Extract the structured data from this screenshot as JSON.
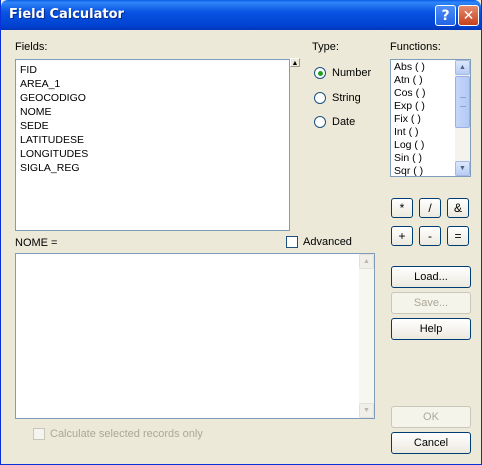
{
  "window": {
    "title": "Field Calculator"
  },
  "titlebar": {
    "help_glyph": "?",
    "close_glyph": "✕"
  },
  "fields": {
    "label": "Fields:",
    "items": [
      "FID",
      "AREA_1",
      "GEOCODIGO",
      "NOME",
      "SEDE",
      "LATITUDESE",
      "LONGITUDES",
      "SIGLA_REG"
    ]
  },
  "type": {
    "label": "Type:",
    "options": [
      "Number",
      "String",
      "Date"
    ],
    "selected": "Number"
  },
  "functions": {
    "label": "Functions:",
    "items": [
      "Abs ( )",
      "Atn ( )",
      "Cos ( )",
      "Exp ( )",
      "Fix ( )",
      "Int ( )",
      "Log ( )",
      "Sin ( )",
      "Sqr ( )"
    ]
  },
  "operators": [
    "*",
    "/",
    "&",
    "+",
    "-",
    "="
  ],
  "expression": {
    "label": "NOME =",
    "value": ""
  },
  "advanced": {
    "label": "Advanced",
    "checked": false
  },
  "buttons": {
    "load": "Load...",
    "save": "Save...",
    "help": "Help",
    "ok": "OK",
    "cancel": "Cancel"
  },
  "selected_only": {
    "label": "Calculate selected records only",
    "checked": false
  }
}
